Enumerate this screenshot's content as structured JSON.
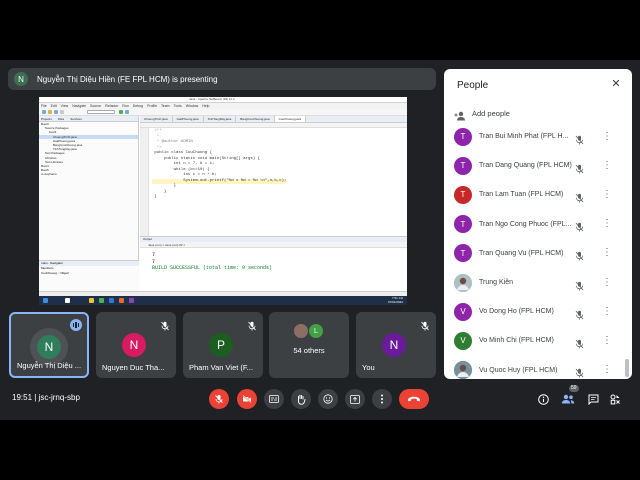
{
  "presenter": {
    "avatar_letter": "N",
    "text": "Nguyễn Thị Diệu Hiền (FE FPL HCM) is presenting"
  },
  "shared_screen": {
    "ide_title": "Java - Apache NetBeans IDE 12.4",
    "menu": [
      "File",
      "Edit",
      "View",
      "Navigate",
      "Source",
      "Refactor",
      "Run",
      "Debug",
      "Profile",
      "Team",
      "Tools",
      "Window",
      "Help"
    ],
    "project_tabs": [
      "Projects",
      "Files",
      "Services"
    ],
    "tree": [
      "Buoi3",
      "Source Packages",
      "buoi3",
      "ChuongTrinh.java",
      "GiaiPhuong.java",
      "BangCuuChuong.java",
      "TinhTongDay.java",
      "Test Packages",
      "Libraries",
      "Test Libraries",
      "Buoi4",
      "Buoi5",
      "vi-du-jframe"
    ],
    "selected_tree_index": 3,
    "navigator_title": "main - Navigator",
    "navigator_rows": [
      "Members",
      "CuuChuong :: Object"
    ],
    "editor_tabs": [
      "ChuongTrinh.java",
      "GiaiPhuong.java",
      "TinhTongDay.java",
      "BangCuuChuong.java",
      "CuuChuong.java"
    ],
    "active_editor_tab": 4,
    "code_lines": [
      " /**",
      "  *",
      "  * @author ADMIN",
      "  */",
      " public class CuuChuong {",
      "     public static void main(String[] args) {",
      "         int n = 7, b = 1;",
      "         while (b<=10) {",
      "             int c = n * b;",
      "             System.out.printf(\"%d x %d = %d \\n\",n,b,c);",
      "         }",
      "     }",
      " }"
    ],
    "highlight_line": 9,
    "output_header": "Output",
    "output_tabs": "Java (run)  ×   Java (run) #2  ×",
    "output_lines": [
      "7",
      "7",
      "BUILD SUCCESSFUL (total time: 0 seconds)"
    ],
    "taskbar_clock": [
      "7:51 CH",
      "07/01/2022"
    ],
    "colors": {
      "output_green": "#0a7d27",
      "taskbar": "#1f2f4a"
    }
  },
  "people_panel": {
    "title": "People",
    "close_icon": "close-icon",
    "add_people_label": "Add people",
    "participants": [
      {
        "name": "Tran Bui Minh Phat (FPL H...",
        "avatar": "T",
        "color": "#8e24aa"
      },
      {
        "name": "Tran Dang Quang (FPL HCM)",
        "avatar": "T",
        "color": "#8e24aa"
      },
      {
        "name": "Tran Lam Tuan (FPL HCM)",
        "avatar": "T",
        "color": "#c62828"
      },
      {
        "name": "Tran Ngo Cong Phuoc (FPL...",
        "avatar": "T",
        "color": "#8e24aa"
      },
      {
        "name": "Tran Quang Vu (FPL HCM)",
        "avatar": "T",
        "color": "#8e24aa"
      },
      {
        "name": "Trung Kiên",
        "avatar": "photo",
        "color": "#b0bec5"
      },
      {
        "name": "Vo Dong Ho (FPL HCM)",
        "avatar": "V",
        "color": "#8e24aa"
      },
      {
        "name": "Vo Minh Chi (FPL HCM)",
        "avatar": "V",
        "color": "#2e7d32"
      },
      {
        "name": "Vu Quoc Huy (FPL HCM)",
        "avatar": "photo",
        "color": "#78909c"
      }
    ]
  },
  "tiles": [
    {
      "name": "Nguyễn Thị Diệu ...",
      "avatar": "N",
      "color": "#2e7d5b",
      "state": "speaking"
    },
    {
      "name": "Nguyen Duc Tha...",
      "avatar": "N",
      "color": "#d81b60",
      "state": "muted"
    },
    {
      "name": "Pham Van Viet (F...",
      "avatar": "P",
      "color": "#1b5e20",
      "state": "muted"
    },
    {
      "name": "54 others",
      "avatar": "L",
      "color": "#43a047",
      "state": "group"
    },
    {
      "name": "You",
      "avatar": "N",
      "color": "#6a1b9a",
      "state": "muted"
    }
  ],
  "bottom_bar": {
    "time_code": "19:51 | jsc-jrnq-sbp",
    "controls": [
      "mic-off-icon",
      "camera-off-icon",
      "captions-icon",
      "raise-hand-icon",
      "emoji-icon",
      "present-icon",
      "more-icon",
      "hang-up-icon"
    ],
    "right_icons": [
      "info-icon",
      "people-icon",
      "chat-icon",
      "activities-icon"
    ],
    "participant_count": "59"
  }
}
